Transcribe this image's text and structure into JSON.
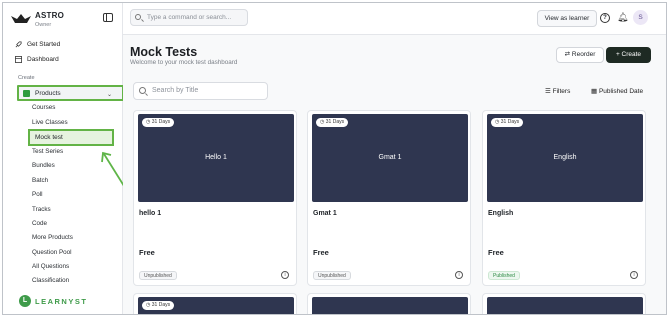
{
  "brand": {
    "name": "ASTRO",
    "role": "Owner"
  },
  "sidebar": {
    "top_items": [
      {
        "label": "Get Started",
        "icon": "rocket-icon"
      },
      {
        "label": "Dashboard",
        "icon": "dashboard-icon"
      }
    ],
    "section_label": "Create",
    "products_label": "Products",
    "products_items": [
      "Courses",
      "Live Classes",
      "Mock test",
      "Test Series",
      "Bundles",
      "Batch",
      "Poll",
      "Tracks",
      "Code",
      "More Products",
      "Question Pool",
      "All Questions",
      "Classification"
    ],
    "footer_brand": "LEARNYST"
  },
  "topbar": {
    "command_placeholder": "Type a command or search...",
    "view_as_learner": "View as learner",
    "avatar_initial": "S"
  },
  "main": {
    "title": "Mock Tests",
    "subtitle": "Welcome to your mock test dashboard",
    "reorder_label": "Reorder",
    "create_label": "+ Create",
    "search_placeholder": "Search by Title",
    "filters_label": "Filters",
    "sort_label": "Published Date"
  },
  "cards": [
    {
      "days": "31 Days",
      "thumb_title": "Hello 1",
      "name": "hello 1",
      "price": "Free",
      "status": "Unpublished"
    },
    {
      "days": "31 Days",
      "thumb_title": "Gmat 1",
      "name": "Gmat 1",
      "price": "Free",
      "status": "Unpublished"
    },
    {
      "days": "31 Days",
      "thumb_title": "English",
      "name": "English",
      "price": "Free",
      "status": "Published"
    }
  ],
  "second_row_cards": [
    {
      "days": "31 Days"
    },
    {
      "days": ""
    },
    {
      "days": ""
    }
  ],
  "colors": {
    "highlight_green": "#63b346",
    "thumb_navy": "#2f3650",
    "create_button": "#1e2a23",
    "published_green": "#2e8b45"
  }
}
